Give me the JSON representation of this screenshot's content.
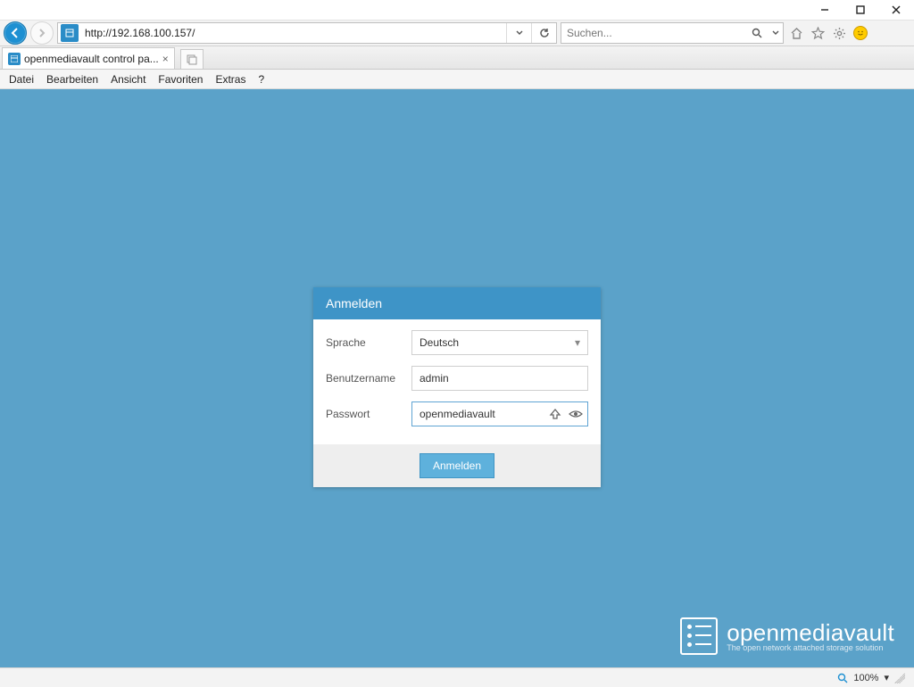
{
  "window": {
    "minimize_tip": "Minimize",
    "maximize_tip": "Maximize",
    "close_tip": "Close"
  },
  "browser": {
    "url": "http://192.168.100.157/",
    "search_placeholder": "Suchen...",
    "tab_title": "openmediavault control pa...",
    "menu": {
      "file": "Datei",
      "edit": "Bearbeiten",
      "view": "Ansicht",
      "favorites": "Favoriten",
      "extras": "Extras",
      "help": "?"
    }
  },
  "login": {
    "heading": "Anmelden",
    "fields": {
      "language_label": "Sprache",
      "language_value": "Deutsch",
      "username_label": "Benutzername",
      "username_value": "admin",
      "password_label": "Passwort",
      "password_value": "openmediavault"
    },
    "submit_label": "Anmelden"
  },
  "brand": {
    "name": "openmediavault",
    "tagline": "The open network attached storage solution"
  },
  "status": {
    "zoom": "100%"
  },
  "colors": {
    "viewport_bg": "#5ba2c9",
    "accent": "#3e94c7"
  }
}
